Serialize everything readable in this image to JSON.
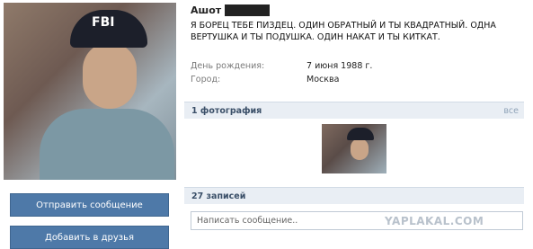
{
  "profile": {
    "name": "Ашот",
    "status": "Я БОРЕЦ ТЕБЕ ПИЗДЕЦ. ОДИН ОБРАТНЫЙ И ТЫ КВАДРАТНЫЙ. ОДНА ВЕРТУШКА И ТЫ ПОДУШКА. ОДИН НАКАТ И ТЫ КИТКАТ.",
    "cap_text": "FBI"
  },
  "info": [
    {
      "label": "День рождения:",
      "value": "7 июня 1988 г."
    },
    {
      "label": "Город:",
      "value": "Москва"
    }
  ],
  "buttons": {
    "send_message": "Отправить сообщение",
    "add_friend": "Добавить в друзья"
  },
  "photos": {
    "header": "1 фотография",
    "all_link": "все"
  },
  "wall": {
    "header": "27 записей",
    "input_placeholder": "Написать сообщение.."
  },
  "watermark": "YAPLAKAL.COM",
  "colors": {
    "button_bg": "#4e79a8",
    "section_bg": "#e9eef4",
    "section_text": "#3a4f68"
  }
}
